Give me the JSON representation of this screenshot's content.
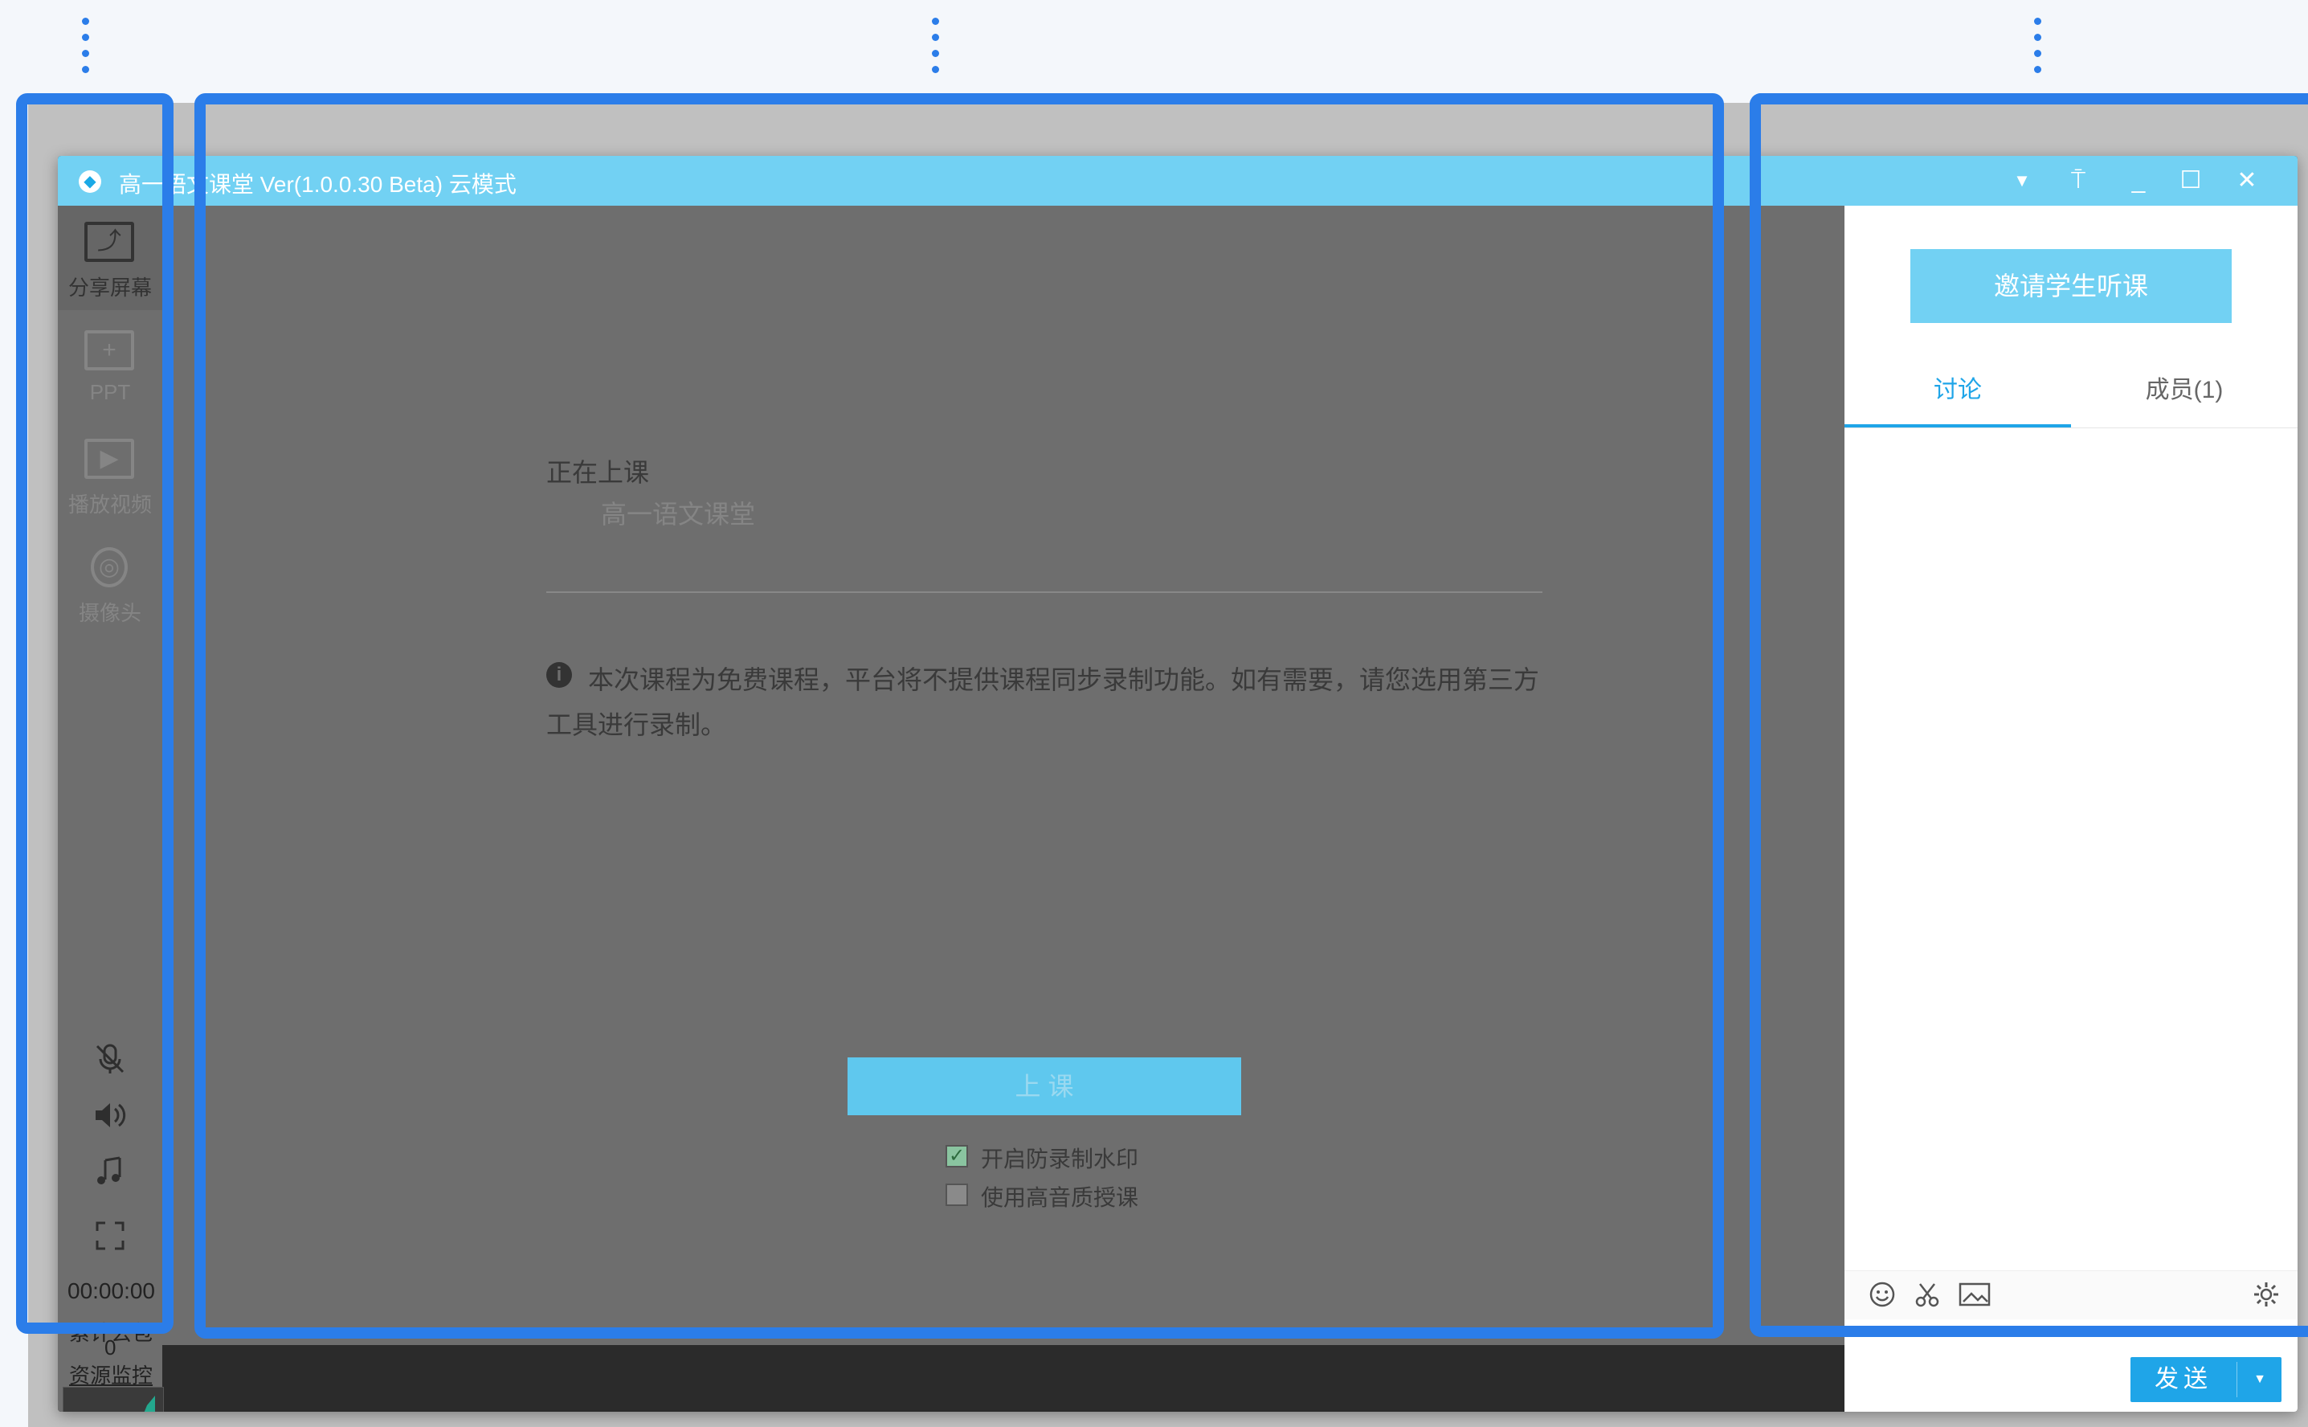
{
  "window": {
    "title": "高一语文课堂 Ver(1.0.0.30 Beta)  云模式",
    "controls": {
      "dropdown": "▼",
      "pin": "⍑",
      "minimize": "_",
      "maximize": "☐",
      "close": "✕"
    }
  },
  "sidebar": {
    "items": [
      {
        "label": "分享屏幕",
        "icon": "share-screen-icon",
        "glyph": "⤴"
      },
      {
        "label": "PPT",
        "icon": "ppt-icon",
        "glyph": "+"
      },
      {
        "label": "播放视频",
        "icon": "play-video-icon",
        "glyph": "▶"
      },
      {
        "label": "摄像头",
        "icon": "camera-icon",
        "glyph": "◎"
      }
    ],
    "timer": "00:00:00",
    "packet_loss_label": "累计丢包",
    "packet_loss_value": "0",
    "resource_monitor": "资源监控"
  },
  "main": {
    "status_title": "正在上课",
    "class_name": "高一语文课堂",
    "notice": "本次课程为免费课程，平台将不提供课程同步录制功能。如有需要，请您选用第三方工具进行录制。",
    "start_button": "上 课",
    "options": [
      {
        "label": "开启防录制水印",
        "checked": true
      },
      {
        "label": "使用高音质授课",
        "checked": false
      }
    ]
  },
  "right_panel": {
    "invite_button": "邀请学生听课",
    "tabs": [
      {
        "label": "讨论",
        "active": true
      },
      {
        "label": "成员(1)",
        "active": false
      }
    ],
    "send_button": "发送",
    "send_dropdown": "▼"
  },
  "colors": {
    "accent": "#1fa5e8",
    "titlebar": "#72d1f3",
    "highlight_frame": "#2b7de9",
    "overlay": "#6e6e6e"
  }
}
